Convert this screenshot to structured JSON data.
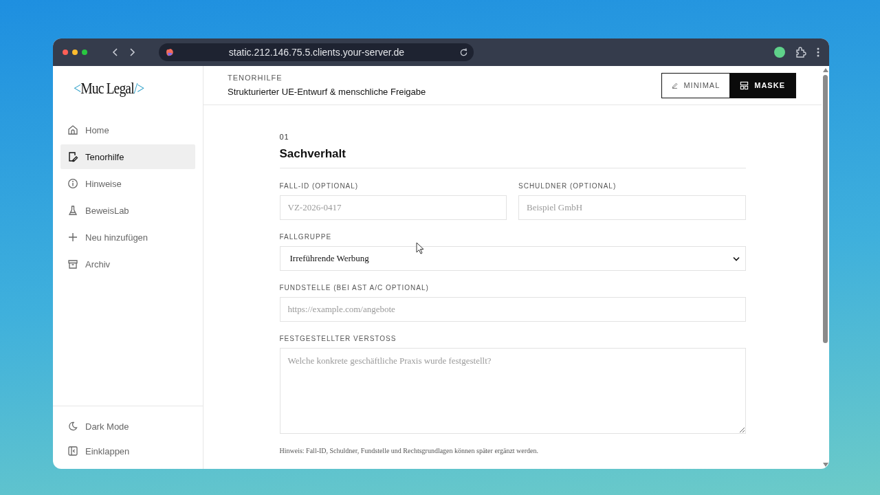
{
  "browser": {
    "url": "static.212.146.75.5.clients.your-server.de"
  },
  "logo": {
    "open": "<",
    "name": "Muc Legal",
    "close": "/>"
  },
  "sidebar": {
    "items": [
      {
        "label": "Home",
        "selected": false
      },
      {
        "label": "Tenorhilfe",
        "selected": true
      },
      {
        "label": "Hinweise",
        "selected": false
      },
      {
        "label": "BeweisLab",
        "selected": false
      },
      {
        "label": "Neu hinzufügen",
        "selected": false
      },
      {
        "label": "Archiv",
        "selected": false
      }
    ],
    "footer": [
      {
        "label": "Dark Mode"
      },
      {
        "label": "Einklappen"
      }
    ]
  },
  "header": {
    "eyebrow": "TENORHILFE",
    "title": "Strukturierter UE-Entwurf & menschliche Freigabe",
    "modes": [
      {
        "label": "MINIMAL",
        "selected": false
      },
      {
        "label": "MASKE",
        "selected": true
      }
    ]
  },
  "section": {
    "number": "01",
    "title": "Sachverhalt",
    "rows": [
      [
        {
          "kind": "input",
          "label": "FALL-ID (OPTIONAL)",
          "placeholder": "VZ-2026-0417"
        },
        {
          "kind": "input",
          "label": "SCHULDNER (OPTIONAL)",
          "placeholder": "Beispiel GmbH"
        }
      ],
      [
        {
          "kind": "select",
          "label": "FALLGRUPPE",
          "value": "Irreführende Werbung"
        }
      ],
      [
        {
          "kind": "input",
          "label": "FUNDSTELLE (BEI AST A/C OPTIONAL)",
          "placeholder": "https://example.com/angebote"
        }
      ],
      [
        {
          "kind": "textarea",
          "label": "FESTGESTELLTER VERSTOSS",
          "placeholder": "Welche konkrete geschäftliche Praxis wurde festgestellt?"
        }
      ]
    ],
    "hint": "Hinweis: Fall-ID, Schuldner, Fundstelle und Rechtsgrundlagen können später ergänzt werden."
  }
}
